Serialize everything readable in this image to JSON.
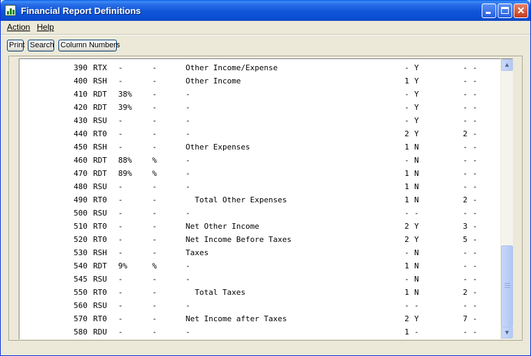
{
  "window": {
    "title": "Financial Report Definitions",
    "controls": {
      "minimize": "minimize",
      "maximize": "maximize",
      "close": "✕"
    }
  },
  "menu": {
    "action": "Action",
    "help": "Help"
  },
  "toolbar": {
    "print": "Print",
    "search": "Search",
    "column_numbers": "Column Numbers"
  },
  "rows": [
    {
      "code": "390",
      "type": "RTX",
      "p1": "-",
      "p2": "-",
      "desc": "Other Income/Expense",
      "f1": "-",
      "f2": "Y",
      "f3": "-",
      "f4": "-"
    },
    {
      "code": "400",
      "type": "RSH",
      "p1": "-",
      "p2": "-",
      "desc": "Other Income",
      "f1": "1",
      "f2": "Y",
      "f3": "-",
      "f4": "-"
    },
    {
      "code": "410",
      "type": "RDT",
      "p1": "38%",
      "p2": "-",
      "desc": "-",
      "f1": "-",
      "f2": "Y",
      "f3": "-",
      "f4": "-"
    },
    {
      "code": "420",
      "type": "RDT",
      "p1": "39%",
      "p2": "-",
      "desc": "-",
      "f1": "-",
      "f2": "Y",
      "f3": "-",
      "f4": "-"
    },
    {
      "code": "430",
      "type": "RSU",
      "p1": "-",
      "p2": "-",
      "desc": "-",
      "f1": "-",
      "f2": "Y",
      "f3": "-",
      "f4": "-"
    },
    {
      "code": "440",
      "type": "RT0",
      "p1": "-",
      "p2": "-",
      "desc": "-",
      "f1": "2",
      "f2": "Y",
      "f3": "2",
      "f4": "-"
    },
    {
      "code": "450",
      "type": "RSH",
      "p1": "-",
      "p2": "-",
      "desc": "Other Expenses",
      "f1": "1",
      "f2": "N",
      "f3": "-",
      "f4": "-"
    },
    {
      "code": "460",
      "type": "RDT",
      "p1": "88%",
      "p2": "%",
      "desc": "-",
      "f1": "-",
      "f2": "N",
      "f3": "-",
      "f4": "-"
    },
    {
      "code": "470",
      "type": "RDT",
      "p1": "89%",
      "p2": "%",
      "desc": "-",
      "f1": "1",
      "f2": "N",
      "f3": "-",
      "f4": "-"
    },
    {
      "code": "480",
      "type": "RSU",
      "p1": "-",
      "p2": "-",
      "desc": "-",
      "f1": "1",
      "f2": "N",
      "f3": "-",
      "f4": "-"
    },
    {
      "code": "490",
      "type": "RT0",
      "p1": "-",
      "p2": "-",
      "desc": "  Total Other Expenses",
      "f1": "1",
      "f2": "N",
      "f3": "2",
      "f4": "-"
    },
    {
      "code": "500",
      "type": "RSU",
      "p1": "-",
      "p2": "-",
      "desc": "-",
      "f1": "-",
      "f2": "-",
      "f3": "-",
      "f4": "-"
    },
    {
      "code": "510",
      "type": "RT0",
      "p1": "-",
      "p2": "-",
      "desc": "Net Other Income",
      "f1": "2",
      "f2": "Y",
      "f3": "3",
      "f4": "-"
    },
    {
      "code": "520",
      "type": "RT0",
      "p1": "-",
      "p2": "-",
      "desc": "Net Income Before Taxes",
      "f1": "2",
      "f2": "Y",
      "f3": "5",
      "f4": "-"
    },
    {
      "code": "530",
      "type": "RSH",
      "p1": "-",
      "p2": "-",
      "desc": "Taxes",
      "f1": "-",
      "f2": "N",
      "f3": "-",
      "f4": "-"
    },
    {
      "code": "540",
      "type": "RDT",
      "p1": "9%",
      "p2": "%",
      "desc": "-",
      "f1": "1",
      "f2": "N",
      "f3": "-",
      "f4": "-"
    },
    {
      "code": "545",
      "type": "RSU",
      "p1": "-",
      "p2": "-",
      "desc": "-",
      "f1": "-",
      "f2": "N",
      "f3": "-",
      "f4": "-"
    },
    {
      "code": "550",
      "type": "RT0",
      "p1": "-",
      "p2": "-",
      "desc": "  Total Taxes",
      "f1": "1",
      "f2": "N",
      "f3": "2",
      "f4": "-"
    },
    {
      "code": "560",
      "type": "RSU",
      "p1": "-",
      "p2": "-",
      "desc": "-",
      "f1": "-",
      "f2": "-",
      "f3": "-",
      "f4": "-"
    },
    {
      "code": "570",
      "type": "RT0",
      "p1": "-",
      "p2": "-",
      "desc": "Net Income after Taxes",
      "f1": "2",
      "f2": "Y",
      "f3": "7",
      "f4": "-"
    },
    {
      "code": "580",
      "type": "RDU",
      "p1": "-",
      "p2": "-",
      "desc": "-",
      "f1": "1",
      "f2": "-",
      "f3": "-",
      "f4": "-"
    }
  ],
  "scrollbar": {
    "up_glyph": "▲",
    "down_glyph": "▼"
  }
}
